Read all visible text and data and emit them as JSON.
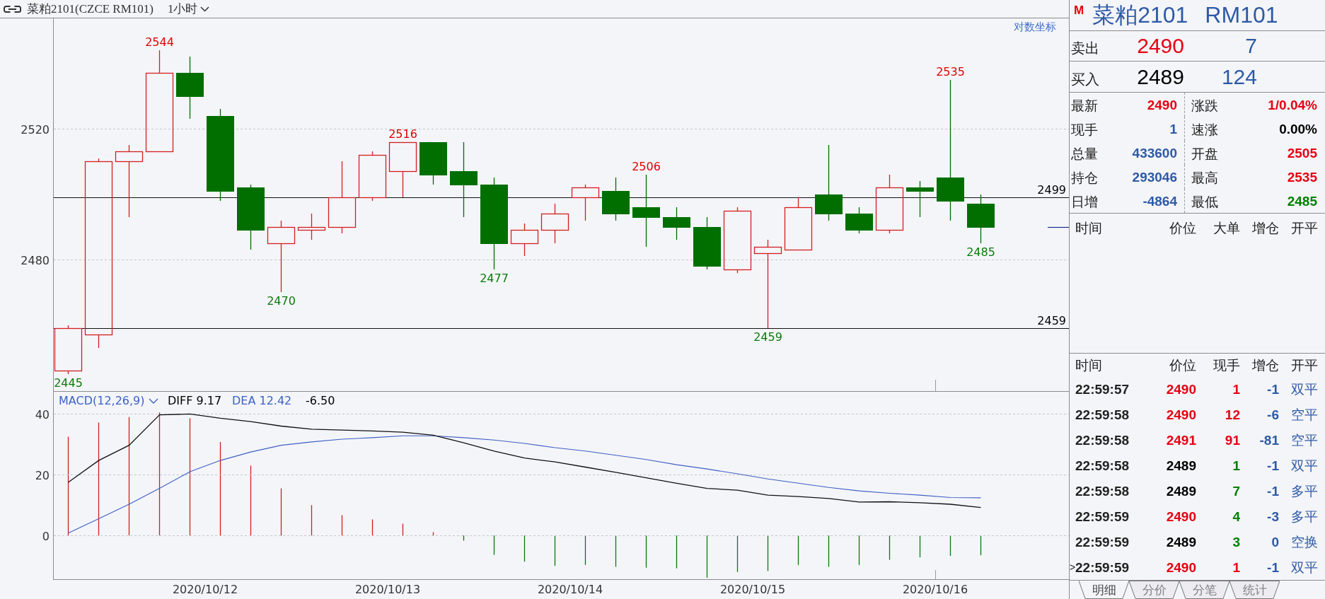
{
  "header": {
    "title": "菜粕2101(CZCE RM101)",
    "period": "1小时"
  },
  "chart": {
    "log_scale": "对数坐标",
    "y_axis_labels": [
      "2520",
      "2480"
    ],
    "level_lines": [
      {
        "label": "2499"
      },
      {
        "label": "2459"
      }
    ],
    "candles": [
      {
        "kind": "up",
        "low_label": "2445"
      },
      {
        "kind": "up"
      },
      {
        "kind": "up"
      },
      {
        "kind": "up",
        "high_label": "2544"
      },
      {
        "kind": "down"
      },
      {
        "kind": "down"
      },
      {
        "kind": "down"
      },
      {
        "kind": "up",
        "low_label": "2470"
      },
      {
        "kind": "up"
      },
      {
        "kind": "up"
      },
      {
        "kind": "up"
      },
      {
        "kind": "up",
        "high_label": "2516"
      },
      {
        "kind": "down"
      },
      {
        "kind": "down"
      },
      {
        "kind": "down",
        "low_label": "2477"
      },
      {
        "kind": "up"
      },
      {
        "kind": "up"
      },
      {
        "kind": "up"
      },
      {
        "kind": "down"
      },
      {
        "kind": "down",
        "high_label": "2506"
      },
      {
        "kind": "down"
      },
      {
        "kind": "down"
      },
      {
        "kind": "up"
      },
      {
        "kind": "up",
        "low_label": "2459"
      },
      {
        "kind": "up"
      },
      {
        "kind": "down"
      },
      {
        "kind": "down"
      },
      {
        "kind": "up"
      },
      {
        "kind": "down"
      },
      {
        "kind": "down",
        "high_label": "2535"
      },
      {
        "kind": "down",
        "low_label": "2485"
      }
    ]
  },
  "macd": {
    "indicator": "MACD(12,26,9)",
    "diff_value": "9.17",
    "dea_value": "12.42",
    "value": "-6.50",
    "chart_data": {
      "type": "line",
      "ylim": [
        -14.5,
        170.2
      ],
      "yticks": [
        0,
        20,
        40
      ],
      "grid": true,
      "series": [
        {
          "name": "DIFF",
          "color": "#111111",
          "values": [
            17.5,
            24.7,
            29.7,
            39.7,
            40,
            38.6,
            37.5,
            36,
            35,
            34.7,
            34.4,
            34,
            33,
            30.5,
            27.8,
            25.5,
            24.2,
            22.5,
            20.8,
            19,
            17.2,
            15.5,
            14.9,
            13.3,
            12.8,
            12.2,
            11,
            11.1,
            10.8,
            10.3,
            9.2
          ]
        },
        {
          "name": "DEA",
          "color": "#3f5fc4",
          "values": [
            0.8,
            5.5,
            10.3,
            15.5,
            21,
            24.7,
            27.5,
            29.7,
            30.8,
            31.7,
            32.2,
            32.8,
            32.8,
            32.2,
            31.4,
            30.3,
            28.9,
            27.8,
            26.4,
            25,
            23.3,
            21.9,
            20.3,
            18.6,
            17.2,
            15.8,
            14.7,
            13.9,
            13.3,
            12.5,
            12.4
          ]
        }
      ]
    }
  },
  "date_labels": [
    "2020/10/12",
    "2020/10/13",
    "2020/10/14",
    "2020/10/15",
    "2020/10/16"
  ],
  "quote": {
    "flag": "M",
    "name": "菜粕2101",
    "code": "RM101"
  },
  "order_book": [
    {
      "label": "卖出",
      "price": {
        "text": "2490",
        "color": "#e60012"
      },
      "volume": "7"
    },
    {
      "label": "买入",
      "price": {
        "text": "2489",
        "color": "#000000"
      },
      "volume": "124"
    }
  ],
  "stats": [
    {
      "label": "最新",
      "value": "2490",
      "color": "#e60012"
    },
    {
      "label": "涨跌",
      "value": "1/0.04%",
      "color": "#e60012"
    },
    {
      "label": "现手",
      "value": "1",
      "color": "#2e5aa6"
    },
    {
      "label": "速涨",
      "value": "0.00%",
      "color": "#000000"
    },
    {
      "label": "总量",
      "value": "433600",
      "color": "#2e5aa6"
    },
    {
      "label": "开盘",
      "value": "2505",
      "color": "#e60012"
    },
    {
      "label": "持仓",
      "value": "293046",
      "color": "#2e5aa6"
    },
    {
      "label": "最高",
      "value": "2535",
      "color": "#e60012"
    },
    {
      "label": "日增",
      "value": "-4864",
      "color": "#2e5aa6"
    },
    {
      "label": "最低",
      "value": "2485",
      "color": "#008000"
    }
  ],
  "big_orders": {
    "columns": [
      "时间",
      "价位",
      "大单",
      "增仓",
      "开平"
    ]
  },
  "trades": {
    "columns": [
      "时间",
      "价位",
      "现手",
      "增仓",
      "开平"
    ],
    "row_marker": ">",
    "rows": [
      {
        "time": "22:59:57",
        "price": {
          "text": "2490",
          "color": "#e60012"
        },
        "volume": {
          "text": "1",
          "color": "#e60012"
        },
        "oi_change": "-1",
        "type": "双平",
        "selected": false
      },
      {
        "time": "22:59:58",
        "price": {
          "text": "2490",
          "color": "#e60012"
        },
        "volume": {
          "text": "12",
          "color": "#e60012"
        },
        "oi_change": "-6",
        "type": "空平",
        "selected": false
      },
      {
        "time": "22:59:58",
        "price": {
          "text": "2491",
          "color": "#e60012"
        },
        "volume": {
          "text": "91",
          "color": "#e60012"
        },
        "oi_change": "-81",
        "type": "空平",
        "selected": false
      },
      {
        "time": "22:59:58",
        "price": {
          "text": "2489",
          "color": "#000000"
        },
        "volume": {
          "text": "1",
          "color": "#008000"
        },
        "oi_change": "-1",
        "type": "双平",
        "selected": false
      },
      {
        "time": "22:59:58",
        "price": {
          "text": "2489",
          "color": "#000000"
        },
        "volume": {
          "text": "7",
          "color": "#008000"
        },
        "oi_change": "-1",
        "type": "多平",
        "selected": false
      },
      {
        "time": "22:59:59",
        "price": {
          "text": "2490",
          "color": "#e60012"
        },
        "volume": {
          "text": "4",
          "color": "#008000"
        },
        "oi_change": "-3",
        "type": "多平",
        "selected": false
      },
      {
        "time": "22:59:59",
        "price": {
          "text": "2489",
          "color": "#000000"
        },
        "volume": {
          "text": "3",
          "color": "#008000"
        },
        "oi_change": "0",
        "type": "空换",
        "selected": false
      },
      {
        "time": "22:59:59",
        "price": {
          "text": "2490",
          "color": "#e60012"
        },
        "volume": {
          "text": "1",
          "color": "#e60012"
        },
        "oi_change": "-1",
        "type": "双平",
        "selected": true
      }
    ]
  },
  "bottom_tabs": [
    {
      "label": "明细",
      "selected": true
    },
    {
      "label": "分价",
      "selected": false
    },
    {
      "label": "分笔",
      "selected": false
    },
    {
      "label": "统计",
      "selected": false
    }
  ]
}
